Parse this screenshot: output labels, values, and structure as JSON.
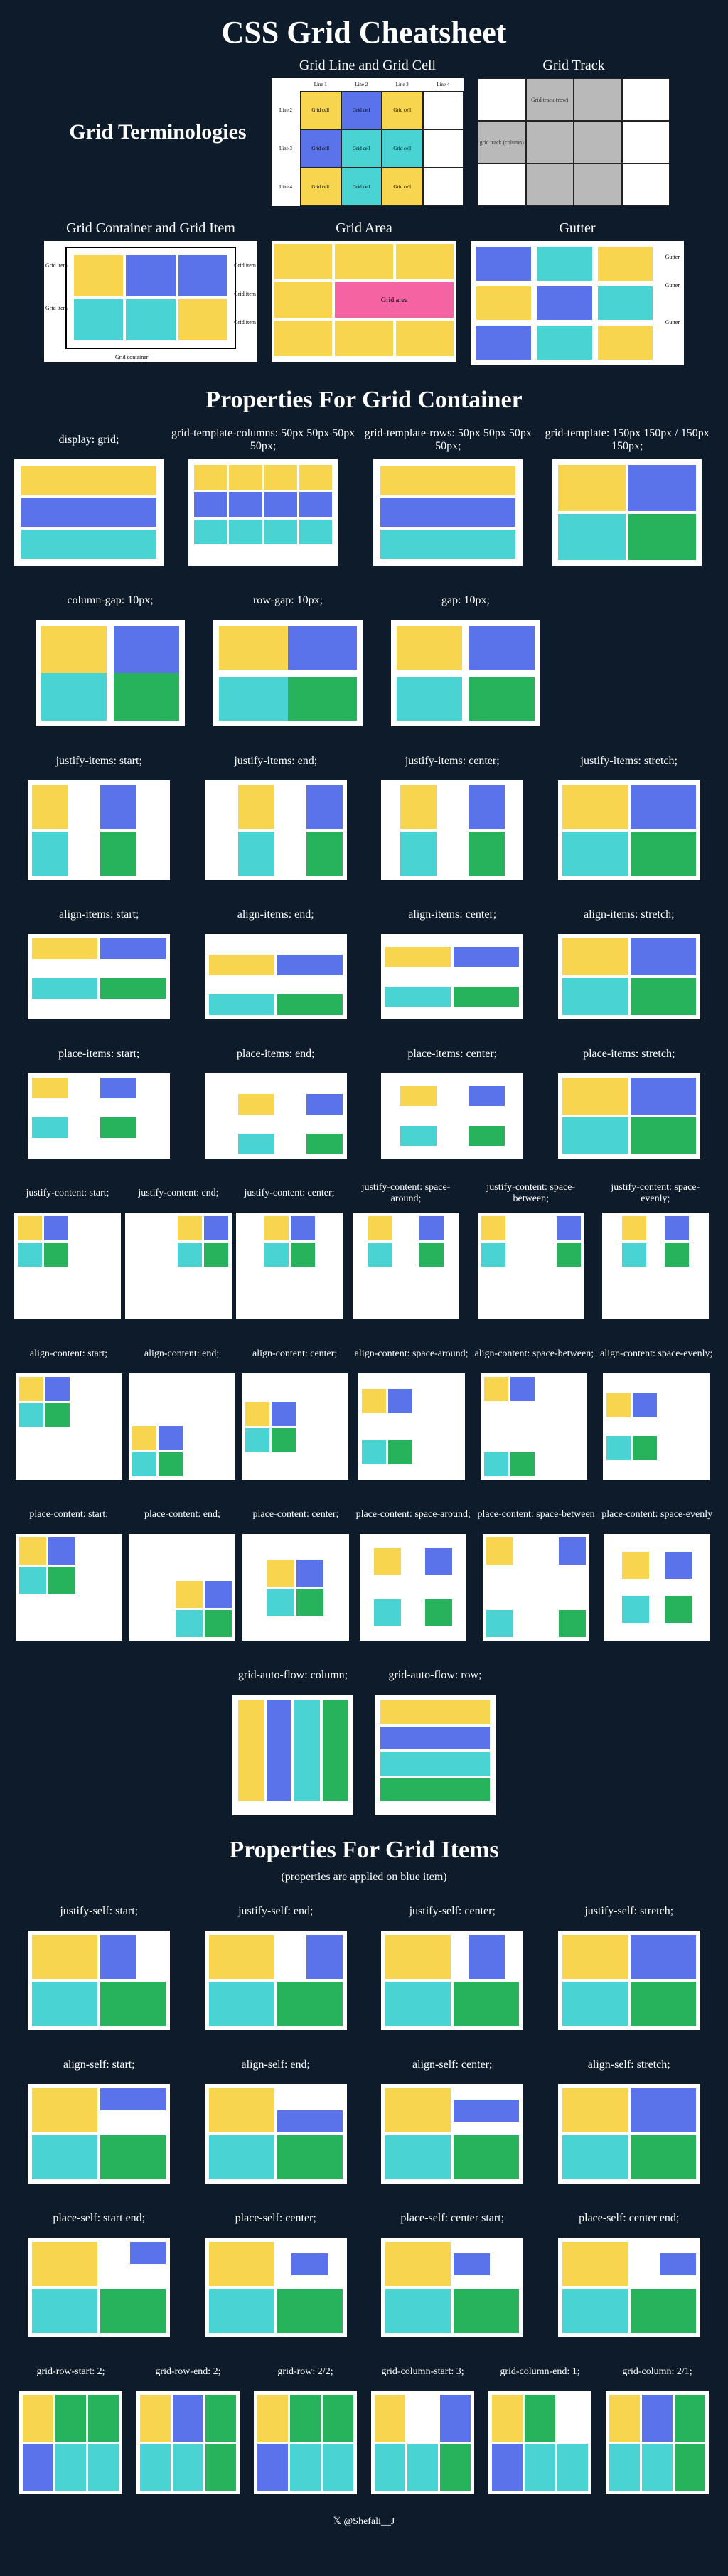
{
  "title": "CSS Grid Cheatsheet",
  "terminology_header": "Grid Terminologies",
  "terminology": {
    "grid_line_cell": "Grid Line and Grid Cell",
    "grid_track": "Grid Track",
    "grid_container_item": "Grid Container and Grid Item",
    "grid_area": "Grid Area",
    "gutter": "Gutter",
    "grid_cell_label": "Grid cell",
    "line1": "Line 1",
    "line2": "Line 2",
    "line3": "Line 3",
    "line4": "Line 4",
    "track_row_label": "Grid track (row)",
    "track_col_label": "grid track (column)",
    "grid_item_label": "Grid item",
    "grid_container_label": "Grid container",
    "grid_area_label": "Grid area",
    "gutter_label": "Gutter"
  },
  "section_container": "Properties For Grid  Container",
  "section_items": "Properties For Grid  Items",
  "items_note": "(properties are applied on blue item)",
  "p": {
    "display_grid": "display: grid;",
    "gtc": "grid-template-columns: 50px 50px 50px 50px;",
    "gtr": "grid-template-rows: 50px 50px 50px 50px;",
    "gt": "grid-template: 150px 150px / 150px 150px;",
    "colgap": "column-gap: 10px;",
    "rowgap": "row-gap: 10px;",
    "gap": "gap: 10px;",
    "ji_start": "justify-items: start;",
    "ji_end": "justify-items: end;",
    "ji_center": "justify-items: center;",
    "ji_stretch": "justify-items: stretch;",
    "ai_start": "align-items: start;",
    "ai_end": "align-items: end;",
    "ai_center": "align-items: center;",
    "ai_stretch": "align-items: stretch;",
    "pi_start": "place-items: start;",
    "pi_end": "place-items: end;",
    "pi_center": "place-items: center;",
    "pi_stretch": "place-items: stretch;",
    "jc_start": "justify-content: start;",
    "jc_end": "justify-content: end;",
    "jc_center": "justify-content: center;",
    "jc_sa": "justify-content: space-around;",
    "jc_sb": "justify-content: space-between;",
    "jc_se": "justify-content: space-evenly;",
    "ac_start": "align-content: start;",
    "ac_end": "align-content: end;",
    "ac_center": "align-content: center;",
    "ac_sa": "align-content: space-around;",
    "ac_sb": "align-content: space-between;",
    "ac_se": "align-content: space-evenly;",
    "pc_start": "place-content: start;",
    "pc_end": "place-content: end;",
    "pc_center": "place-content: center;",
    "pc_sa": "place-content: space-around;",
    "pc_sb": "place-content: space-between",
    "pc_se": "place-content: space-evenly",
    "gaf_col": "grid-auto-flow: column;",
    "gaf_row": "grid-auto-flow: row;",
    "js_start": "justify-self: start;",
    "js_end": "justify-self: end;",
    "js_center": "justify-self: center;",
    "js_stretch": "justify-self: stretch;",
    "as_start": "align-self: start;",
    "as_end": "align-self: end;",
    "as_center": "align-self: center;",
    "as_stretch": "align-self: stretch;",
    "ps_se": "place-self: start end;",
    "ps_c": "place-self: center;",
    "ps_cs": "place-self: center start;",
    "ps_ce": "place-self: center end;",
    "grs": "grid-row-start: 2;",
    "gre": "grid-row-end: 2;",
    "gr": "grid-row: 2/2;",
    "gcs": "grid-column-start: 3;",
    "gce": "grid-column-end: 1;",
    "gc": "grid-column: 2/1;"
  },
  "credit": "𝕏 @Shefali__J"
}
